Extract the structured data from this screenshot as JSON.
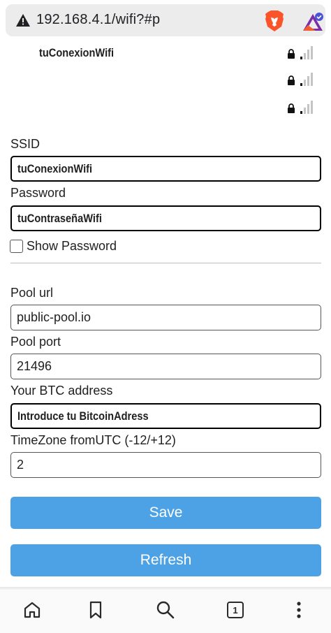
{
  "browser": {
    "url": "192.168.4.1/wifi?#p",
    "icons": [
      "warning-icon",
      "brave-lion-icon",
      "brave-rewards-icon"
    ]
  },
  "networks": [
    {
      "ssid": "tuConexionWifi",
      "secured": true,
      "signal": 1
    },
    {
      "ssid": "",
      "secured": true,
      "signal": 1
    },
    {
      "ssid": "",
      "secured": true,
      "signal": 1
    }
  ],
  "form": {
    "ssid_label": "SSID",
    "ssid_value": "tuConexionWifi",
    "password_label": "Password",
    "password_value": "tuContraseñaWifi",
    "show_password_label": "Show Password",
    "show_password_checked": false,
    "pool_url_label": "Pool url",
    "pool_url_value": "public-pool.io",
    "pool_port_label": "Pool port",
    "pool_port_value": "21496",
    "btc_label": "Your BTC address",
    "btc_value": "Introduce tu BitcoinAdress",
    "tz_label": "TimeZone fromUTC (-12/+12)",
    "tz_value": "2",
    "save_label": "Save",
    "refresh_label": "Refresh"
  },
  "colors": {
    "button": "#4da2e6",
    "brave_orange": "#fb542b"
  },
  "bottom_nav": {
    "tab_count": "1",
    "icons": [
      "home-icon",
      "bookmark-icon",
      "search-icon",
      "tabs-icon",
      "more-icon"
    ]
  }
}
